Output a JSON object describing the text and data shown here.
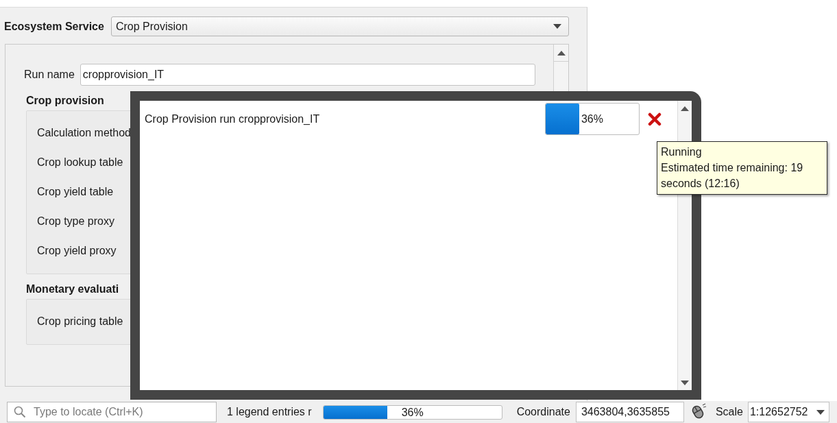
{
  "ecosystem_service": {
    "label": "Ecosystem Service",
    "value": "Crop Provision"
  },
  "form": {
    "run_name": {
      "label": "Run name",
      "value": "cropprovision_IT"
    },
    "sections": [
      {
        "title": "Crop provision",
        "fields": [
          "Calculation method",
          "Crop lookup table",
          "Crop yield table",
          "Crop type proxy",
          "Crop yield proxy"
        ]
      },
      {
        "title": "Monetary evaluati",
        "fields": [
          "Crop pricing table"
        ]
      }
    ]
  },
  "task_dialog": {
    "tasks": [
      {
        "name": "Crop Provision run cropprovision_IT",
        "level": 0.36,
        "reading": "36%"
      }
    ],
    "tooltip": {
      "title": "Running",
      "lines": [
        "Estimated time remaining: 19",
        "seconds (12:16)"
      ]
    }
  },
  "status_bar": {
    "search_placeholder": "Type to locate (Ctrl+K)",
    "message": "1 legend entries r",
    "progress": {
      "level": 0.36,
      "reading": "36%"
    },
    "coordinate_label": "Coordinate",
    "coordinate": "3463804,3635855",
    "scale_label": "Scale",
    "scale": "1:12652752"
  }
}
